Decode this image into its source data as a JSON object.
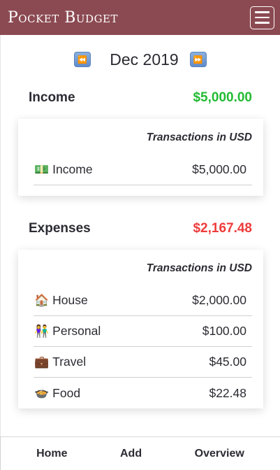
{
  "app": {
    "title": "Pocket Budget",
    "menu_icon": "hamburger-menu-icon"
  },
  "month_nav": {
    "label": "Dec 2019",
    "prev_icon": "rewind-icon",
    "next_icon": "fast-forward-icon",
    "prev_glyph": "⏪",
    "next_glyph": "⏩"
  },
  "income": {
    "title": "Income",
    "total": "$5,000.00",
    "caption": "Transactions in USD",
    "rows": [
      {
        "emoji": "💵",
        "label": "Income",
        "amount": "$5,000.00"
      }
    ]
  },
  "expenses": {
    "title": "Expenses",
    "total": "$2,167.48",
    "caption": "Transactions in USD",
    "rows": [
      {
        "emoji": "🏠",
        "label": "House",
        "amount": "$2,000.00"
      },
      {
        "emoji": "👫",
        "label": "Personal",
        "amount": "$100.00"
      },
      {
        "emoji": "💼",
        "label": "Travel",
        "amount": "$45.00"
      },
      {
        "emoji": "🍲",
        "label": "Food",
        "amount": "$22.48"
      }
    ]
  },
  "tabs": [
    {
      "label": "Home"
    },
    {
      "label": "Add"
    },
    {
      "label": "Overview"
    }
  ],
  "colors": {
    "header": "#8b4a52",
    "positive": "#22bb33",
    "negative": "#ef3b3b"
  }
}
